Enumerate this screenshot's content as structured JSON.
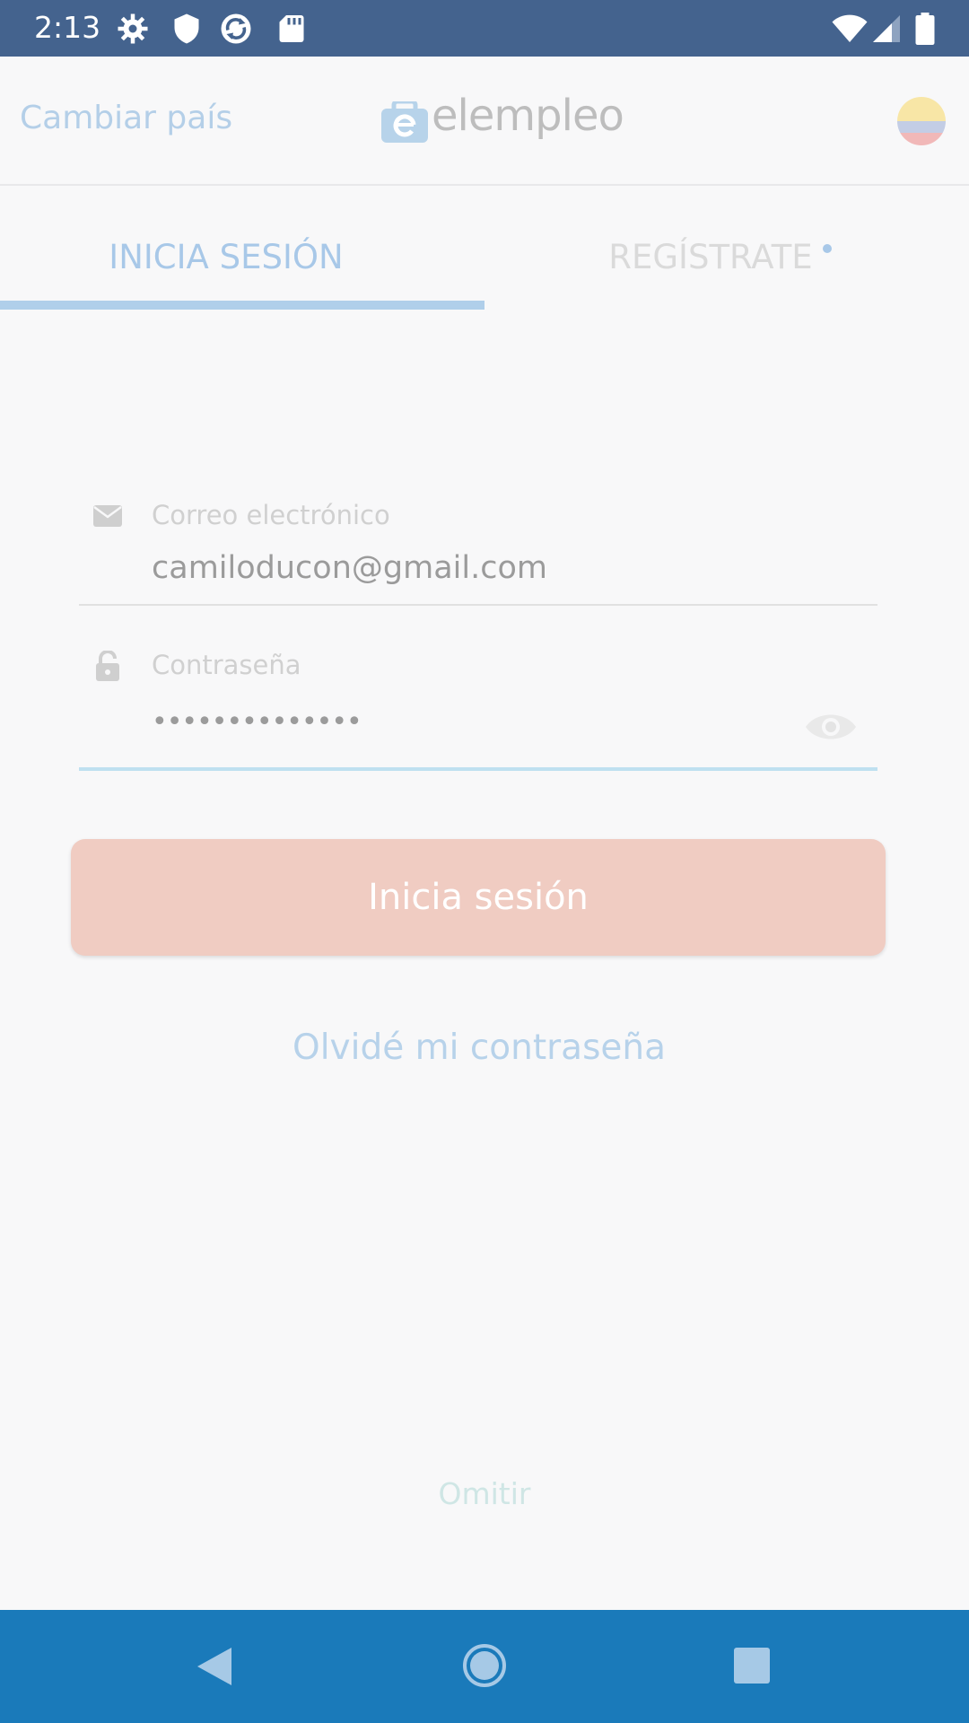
{
  "status_bar": {
    "time": "2:13",
    "left_icons": [
      "gear-icon",
      "shield-icon",
      "sync-icon",
      "sd-card-icon"
    ],
    "right_icons": [
      "wifi-icon",
      "signal-icon",
      "battery-icon"
    ]
  },
  "header": {
    "change_country": "Cambiar país",
    "logo_text": "elempleo",
    "country_flag": "colombia-flag"
  },
  "tabs": {
    "login": "INICIA SESIÓN",
    "register": "REGÍSTRATE"
  },
  "form": {
    "email_label": "Correo electrónico",
    "email_value": "camiloducon@gmail.com",
    "password_label": "Contraseña",
    "password_value": "••••••••••••••"
  },
  "actions": {
    "login_button": "Inicia sesión",
    "forgot_password": "Olvidé mi contraseña",
    "skip": "Omitir"
  },
  "colors": {
    "status_bar": "#44638e",
    "accent_blue": "#a8c8e8",
    "button": "#f0ccc2",
    "nav_bar": "#1a7aba"
  }
}
